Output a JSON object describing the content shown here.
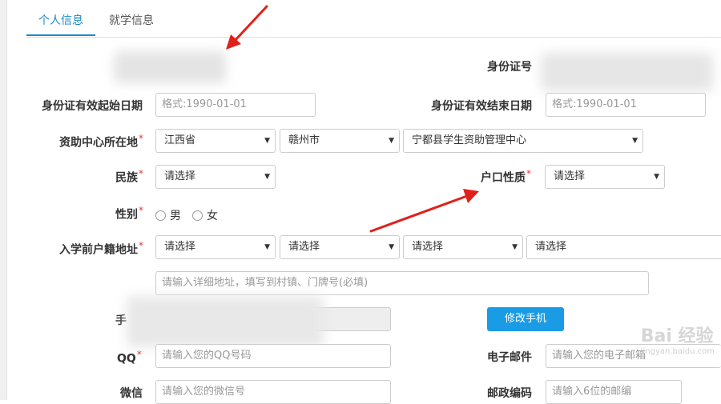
{
  "tabs": [
    {
      "label": "个人信息",
      "active": true
    },
    {
      "label": "就学信息",
      "active": false
    }
  ],
  "fields": {
    "id_number_label": "身份证号",
    "id_start_label": "身份证有效起始日期",
    "id_start_placeholder": "格式:1990-01-01",
    "id_end_label": "身份证有效结束日期",
    "id_end_placeholder": "格式:1990-01-01",
    "aid_center_label": "资助中心所在地",
    "aid_center_province": "江西省",
    "aid_center_city": "赣州市",
    "aid_center_name": "宁都县学生资助管理中心",
    "ethnicity_label": "民族",
    "ethnicity_value": "请选择",
    "household_type_label": "户口性质",
    "household_type_value": "请选择",
    "gender_label": "性别",
    "gender_male": "男",
    "gender_female": "女",
    "household_address_label": "入学前户籍地址",
    "address_select_1": "请选择",
    "address_select_2": "请选择",
    "address_select_3": "请选择",
    "address_select_4": "请选择",
    "address_detail_placeholder": "请输入详细地址，填写到村镇、门牌号(必填)",
    "phone_label_partial": "手",
    "change_phone_button": "修改手机",
    "qq_label": "QQ",
    "qq_placeholder": "请输入您的QQ号码",
    "email_label": "电子邮件",
    "email_placeholder": "请输入您的电子邮箱",
    "wechat_label": "微信",
    "wechat_placeholder": "请输入您的微信号",
    "postal_label": "邮政编码",
    "postal_placeholder": "请输入6位的邮编",
    "required_mark": "*"
  },
  "watermark": {
    "brand": "Bai 经验",
    "url": "jingyan.baidu.com"
  },
  "colors": {
    "accent": "#1e88c8",
    "button": "#1a9be6",
    "required": "#e53935",
    "arrow": "#e0201b"
  }
}
